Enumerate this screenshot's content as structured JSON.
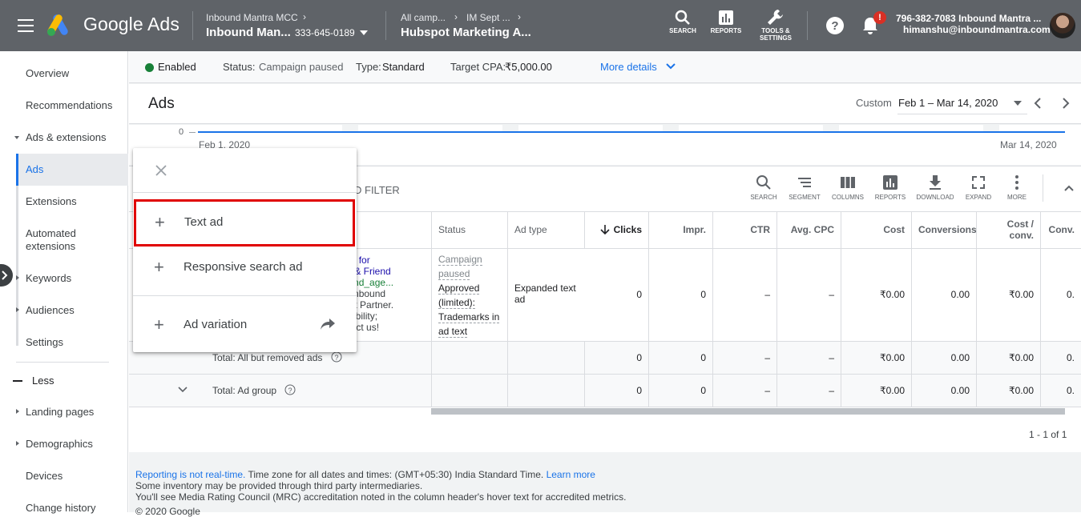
{
  "topbar": {
    "brand": "Google Ads",
    "account_parent": "Inbound Mantra MCC",
    "account_name": "Inbound Man...",
    "account_id": "333-645-0189",
    "crumb_all": "All camp...",
    "crumb_campaign": "IM Sept ...",
    "crumb_current": "Hubspot Marketing A...",
    "tools": [
      "SEARCH",
      "REPORTS",
      "TOOLS &",
      "SETTINGS"
    ],
    "notification_count": "!",
    "user_line1": "796-382-7083 Inbound Mantra ...",
    "user_line2": "himanshu@inboundmantra.com"
  },
  "sidebar": {
    "items": [
      "Overview",
      "Recommendations",
      "Ads & extensions",
      "Ads",
      "Extensions",
      "Automated",
      "extensions",
      "Keywords",
      "Audiences",
      "Settings",
      "Less",
      "Landing pages",
      "Demographics",
      "Devices",
      "Change history"
    ]
  },
  "status": {
    "enabled": "Enabled",
    "status_label": "Status:",
    "status_value": "Campaign paused",
    "type_label": "Type:",
    "type_value": "Standard",
    "cpa_label": "Target CPA:",
    "cpa_value": "₹5,000.00",
    "more_details": "More details"
  },
  "header": {
    "title": "Ads",
    "custom": "Custom",
    "date_range": "Feb 1 – Mar 14, 2020"
  },
  "chart": {
    "y_tick": "0",
    "x_start": "Feb 1, 2020",
    "x_end": "Mar 14, 2020"
  },
  "table": {
    "filter_label": "D FILTER",
    "tools": [
      "SEARCH",
      "SEGMENT",
      "COLUMNS",
      "REPORTS",
      "DOWNLOAD",
      "EXPAND",
      "MORE"
    ],
    "columns": [
      "Status",
      "Ad type",
      "Clicks",
      "Impr.",
      "CTR",
      "Avg. CPC",
      "Cost",
      "Conversions",
      "Cost /",
      "conv.",
      "Conv."
    ],
    "ad_text": [
      "tand for",
      "ical & Friend",
      "bound_age...",
      "ng Inbound",
      "Spot Partner.",
      "ofitability;",
      "ontact us!"
    ],
    "row1": {
      "status": [
        "Campaign",
        "paused",
        "Approved",
        "(limited):",
        "Trademarks in",
        "ad text"
      ],
      "ad_type": [
        "Expanded text",
        "ad"
      ],
      "clicks": "0",
      "impr": "0",
      "ctr": "–",
      "cpc": "–",
      "cost": "₹0.00",
      "conversions": "0.00",
      "cost_conv": "₹0.00",
      "conv": "0."
    },
    "row2": {
      "label": "Total: All but removed ads",
      "clicks": "0",
      "impr": "0",
      "ctr": "–",
      "cpc": "–",
      "cost": "₹0.00",
      "conversions": "0.00",
      "cost_conv": "₹0.00",
      "conv": "0."
    },
    "row3": {
      "label": "Total: Ad group",
      "clicks": "0",
      "impr": "0",
      "ctr": "–",
      "cpc": "–",
      "cost": "₹0.00",
      "conversions": "0.00",
      "cost_conv": "₹0.00",
      "conv": "0."
    },
    "pagination": "1 - 1 of 1"
  },
  "footer": {
    "realtime_link": "Reporting is not real-time.",
    "timezone": " Time zone for all dates and times: (GMT+05:30) India Standard Time. ",
    "learn_more": "Learn more",
    "line2": "Some inventory may be provided through third party intermediaries.",
    "line3": "You'll see Media Rating Council (MRC) accreditation noted in the column header's hover text for accredited metrics.",
    "copyright": "© 2020 Google"
  },
  "popup": {
    "items": [
      "Text ad",
      "Responsive search ad",
      "Ad variation"
    ]
  },
  "colors": {
    "accent": "#1a73e8",
    "highlight": "#e00000",
    "enabled": "#188038",
    "topbar": "#5f6368"
  }
}
